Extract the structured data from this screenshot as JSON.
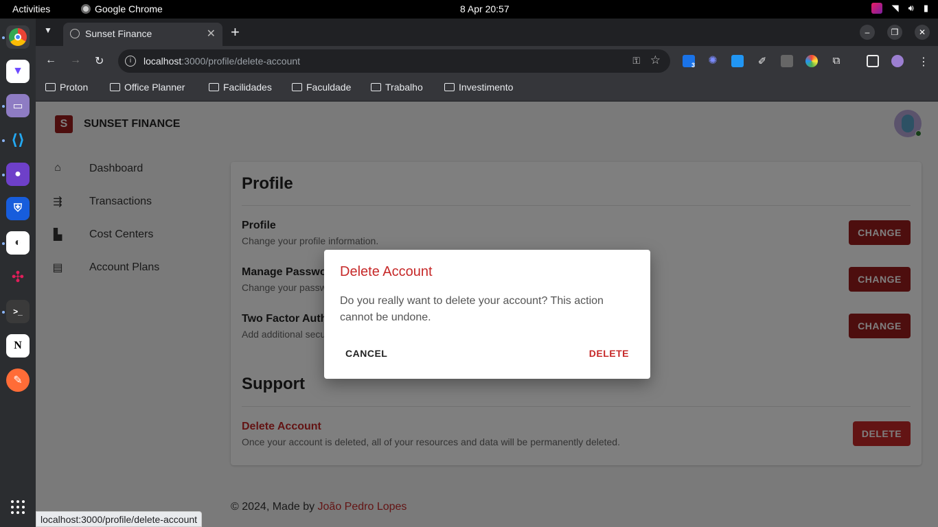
{
  "topbar": {
    "activities": "Activities",
    "app_name": "Google Chrome",
    "clock": "8 Apr  20:57"
  },
  "dock": {
    "items": [
      "chrome-icon",
      "proton-vpn-icon",
      "files-icon",
      "vscode-icon",
      "github-icon",
      "bitwarden-icon",
      "app-icon",
      "slack-icon",
      "terminal-icon",
      "notion-icon",
      "postman-icon"
    ]
  },
  "browser": {
    "tab_title": "Sunset Finance",
    "url_host": "localhost",
    "url_path": ":3000/profile/delete-account",
    "bookmarks": [
      "Proton",
      "Office Planner",
      "Facilidades",
      "Faculdade",
      "Trabalho",
      "Investimento"
    ],
    "ext_badge": "3",
    "status_url": "localhost:3000/profile/delete-account"
  },
  "app": {
    "brand": "SUNSET FINANCE",
    "brand_letter": "S",
    "nav": [
      {
        "label": "Dashboard",
        "icon": "home-icon"
      },
      {
        "label": "Transactions",
        "icon": "transactions-icon"
      },
      {
        "label": "Cost Centers",
        "icon": "building-icon"
      },
      {
        "label": "Account Plans",
        "icon": "file-cabinet-icon"
      }
    ]
  },
  "profile": {
    "heading": "Profile",
    "rows": [
      {
        "title": "Profile",
        "desc": "Change your profile information.",
        "button": "CHANGE"
      },
      {
        "title": "Manage Password",
        "desc": "Change your password.",
        "button": "CHANGE"
      },
      {
        "title": "Two Factor Authentication",
        "desc": "Add additional security to your account.",
        "button": "CHANGE"
      }
    ]
  },
  "support": {
    "heading": "Support",
    "delete_title": "Delete Account",
    "delete_desc": "Once your account is deleted, all of your resources and data will be permanently deleted.",
    "delete_button": "DELETE"
  },
  "footer": {
    "prefix": "© 2024, Made by ",
    "author": "João Pedro Lopes"
  },
  "dialog": {
    "title": "Delete Account",
    "body": "Do you really want to delete your account? This action cannot be undone.",
    "cancel": "CANCEL",
    "confirm": "DELETE"
  },
  "colors": {
    "brand": "#9b1c1c",
    "danger": "#c62828"
  }
}
